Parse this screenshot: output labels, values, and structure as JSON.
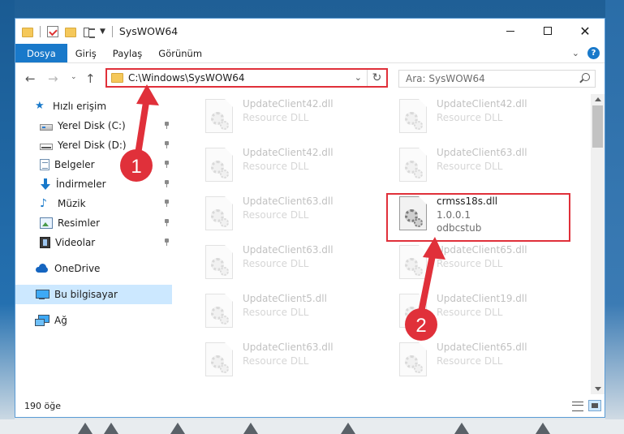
{
  "window": {
    "title": "SysWOW64",
    "controls": {
      "minimize": "minimize",
      "maximize": "maximize",
      "close": "✕"
    }
  },
  "ribbon": {
    "tabs": [
      "Dosya",
      "Giriş",
      "Paylaş",
      "Görünüm"
    ],
    "expand_chevron": "⌄",
    "help": "?"
  },
  "navigation": {
    "back": "←",
    "forward": "→",
    "recent": "⌄",
    "up": "↑",
    "address": "C:\\Windows\\SysWOW64",
    "address_dropdown": "⌄",
    "refresh": "↻",
    "search_placeholder": "Ara: SysWOW64"
  },
  "sidebar": {
    "items": [
      {
        "label": "Hızlı erişim",
        "icon": "star-icon",
        "pinned": false
      },
      {
        "label": "Yerel Disk (C:)",
        "icon": "drive-icon",
        "pinned": true
      },
      {
        "label": "Yerel Disk (D:)",
        "icon": "drive-icon",
        "pinned": true
      },
      {
        "label": "Belgeler",
        "icon": "documents-icon",
        "pinned": true
      },
      {
        "label": "İndirmeler",
        "icon": "download-icon",
        "pinned": true
      },
      {
        "label": "Müzik",
        "icon": "music-icon",
        "pinned": true
      },
      {
        "label": "Resimler",
        "icon": "pictures-icon",
        "pinned": true
      },
      {
        "label": "Videolar",
        "icon": "videos-icon",
        "pinned": true
      },
      {
        "label": "OneDrive",
        "icon": "cloud-icon",
        "pinned": false
      },
      {
        "label": "Bu bilgisayar",
        "icon": "computer-icon",
        "pinned": false,
        "selected": true
      },
      {
        "label": "Ağ",
        "icon": "network-icon",
        "pinned": false
      }
    ]
  },
  "files": {
    "left_column": [
      {
        "name": "UpdateClient42.dll",
        "type": "Resource DLL"
      },
      {
        "name": "UpdateClient42.dll",
        "type": "Resource DLL"
      },
      {
        "name": "UpdateClient63.dll",
        "type": "Resource DLL"
      },
      {
        "name": "UpdateClient63.dll",
        "type": "Resource DLL"
      },
      {
        "name": "UpdateClient5.dll",
        "type": "Resource DLL"
      },
      {
        "name": "UpdateClient63.dll",
        "type": "Resource DLL"
      }
    ],
    "right_column": [
      {
        "name": "UpdateClient42.dll",
        "type": "Resource DLL"
      },
      {
        "name": "UpdateClient63.dll",
        "type": "Resource DLL"
      },
      {
        "name": "UpdateClient65.dll",
        "type": "Resource DLL"
      },
      {
        "name": "UpdateClient19.dll",
        "type": "Resource DLL"
      },
      {
        "name": "UpdateClient65.dll",
        "type": "Resource DLL"
      }
    ],
    "highlighted": {
      "name": "crmss18s.dll",
      "version": "1.0.0.1",
      "description": "odbcstub"
    }
  },
  "status": {
    "item_count": "190 öğe"
  },
  "annotations": [
    {
      "number": "1",
      "color": "#e0303a"
    },
    {
      "number": "2",
      "color": "#e0303a"
    }
  ]
}
